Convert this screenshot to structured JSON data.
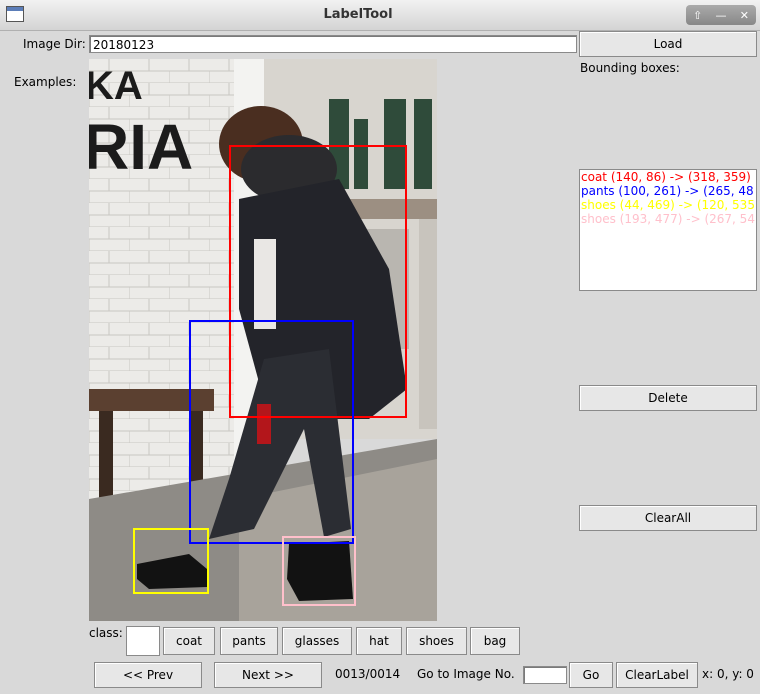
{
  "window": {
    "title": "LabelTool",
    "controls": [
      "restore-icon",
      "minimize-icon",
      "close-icon"
    ]
  },
  "image_dir": {
    "label": "Image Dir:",
    "value": "20180123"
  },
  "examples_label": "Examples:",
  "load_button": "Load",
  "bbox_header": "Bounding boxes:",
  "bboxes": [
    {
      "text": "coat (140, 86) -> (318, 359)",
      "color": "#ff0000"
    },
    {
      "text": "pants (100, 261) -> (265, 48",
      "color": "#0000ff"
    },
    {
      "text": "shoes (44, 469) -> (120, 535",
      "color": "#ffff00"
    },
    {
      "text": "shoes (193, 477) -> (267, 54",
      "color": "#ffc0cb"
    }
  ],
  "delete_button": "Delete",
  "clearall_button": "ClearAll",
  "class_label": "class:",
  "classes": [
    "coat",
    "pants",
    "glasses",
    "hat",
    "shoes",
    "bag"
  ],
  "nav": {
    "prev": "<< Prev",
    "next": "Next >>",
    "progress": "0013/0014",
    "goto_label": "Go to Image No.",
    "goto_value": "",
    "go": "Go",
    "clear_label": "ClearLabel",
    "coords": "x: 0, y: 0"
  }
}
